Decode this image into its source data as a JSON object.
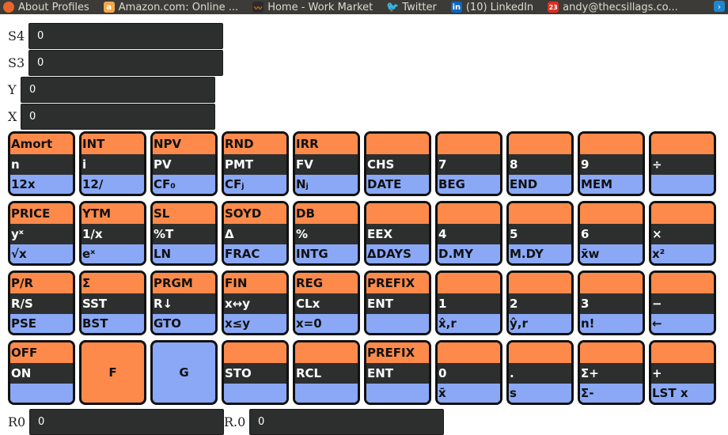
{
  "bookmarks": [
    {
      "label": "About Profiles",
      "icon": "firefox-icon",
      "color": "#e8662c"
    },
    {
      "label": "Amazon.com: Online ...",
      "icon": "amazon-icon",
      "color": "#f3a847"
    },
    {
      "label": "Home - Work Market",
      "icon": "workmarket-icon",
      "color": "#e8781f"
    },
    {
      "label": "Twitter",
      "icon": "twitter-icon",
      "color": "#1da1f2"
    },
    {
      "label": "(10) LinkedIn",
      "icon": "linkedin-icon",
      "color": "#0a66c2"
    },
    {
      "label": "andy@thecsillags.co...",
      "icon": "calendar-icon",
      "color": "#d93025",
      "badge": "23"
    }
  ],
  "stack": {
    "s4": {
      "label": "S4",
      "value": "0"
    },
    "s3": {
      "label": "S3",
      "value": "0"
    },
    "y": {
      "label": "Y",
      "value": "0"
    },
    "x": {
      "label": "X",
      "value": "0"
    }
  },
  "memory": {
    "r0": {
      "label": "R0",
      "value": "0"
    },
    "r_0": {
      "label": "R.0",
      "value": "0"
    }
  },
  "colors": {
    "orange": "#fd8a4a",
    "dark": "#2d2f2f",
    "blue": "#8aa8f6"
  },
  "keys": [
    [
      {
        "top": "Amort",
        "mid": "n",
        "bot": "12x"
      },
      {
        "top": "INT",
        "mid": "i",
        "bot": "12/"
      },
      {
        "top": "NPV",
        "mid": "PV",
        "bot": "CF₀"
      },
      {
        "top": "RND",
        "mid": "PMT",
        "bot": "CFⱼ"
      },
      {
        "top": "IRR",
        "mid": "FV",
        "bot": "Nⱼ"
      },
      {
        "top": "",
        "mid": "CHS",
        "bot": "DATE"
      },
      {
        "top": "",
        "mid": "7",
        "bot": "BEG"
      },
      {
        "top": "",
        "mid": "8",
        "bot": "END"
      },
      {
        "top": "",
        "mid": "9",
        "bot": "MEM"
      },
      {
        "top": "",
        "mid": "÷",
        "bot": ""
      }
    ],
    [
      {
        "top": "PRICE",
        "mid": "yˣ",
        "bot": "√x"
      },
      {
        "top": "YTM",
        "mid": "1/x",
        "bot": "eˣ"
      },
      {
        "top": "SL",
        "mid": "%T",
        "bot": "LN"
      },
      {
        "top": "SOYD",
        "mid": "Δ",
        "bot": "FRAC"
      },
      {
        "top": "DB",
        "mid": "%",
        "bot": "INTG"
      },
      {
        "top": "",
        "mid": "EEX",
        "bot": "ΔDAYS"
      },
      {
        "top": "",
        "mid": "4",
        "bot": "D.MY"
      },
      {
        "top": "",
        "mid": "5",
        "bot": "M.DY"
      },
      {
        "top": "",
        "mid": "6",
        "bot": "x̄w"
      },
      {
        "top": "",
        "mid": "×",
        "bot": "x²"
      }
    ],
    [
      {
        "top": "P/R",
        "mid": "R/S",
        "bot": "PSE"
      },
      {
        "top": "Σ",
        "mid": "SST",
        "bot": "BST"
      },
      {
        "top": "PRGM",
        "mid": "R↓",
        "bot": "GTO"
      },
      {
        "top": "FIN",
        "mid": "x↔y",
        "bot": "x≤y"
      },
      {
        "top": "REG",
        "mid": "CLx",
        "bot": "x=0"
      },
      {
        "top": "PREFIX",
        "mid": "ENT",
        "bot": ""
      },
      {
        "top": "",
        "mid": "1",
        "bot": "x̂,r"
      },
      {
        "top": "",
        "mid": "2",
        "bot": "ŷ,r"
      },
      {
        "top": "",
        "mid": "3",
        "bot": "n!"
      },
      {
        "top": "",
        "mid": "−",
        "bot": "←"
      }
    ],
    [
      {
        "top": "OFF",
        "mid": "ON",
        "bot": ""
      },
      {
        "solid": "orange",
        "label": "F"
      },
      {
        "solid": "blue",
        "label": "G"
      },
      {
        "top": "",
        "mid": "STO",
        "bot": ""
      },
      {
        "top": "",
        "mid": "RCL",
        "bot": ""
      },
      {
        "top": "PREFIX",
        "mid": "ENT",
        "bot": ""
      },
      {
        "top": "",
        "mid": "0",
        "bot": "x̄"
      },
      {
        "top": "",
        "mid": ".",
        "bot": "s"
      },
      {
        "top": "",
        "mid": "Σ+",
        "bot": "Σ-"
      },
      {
        "top": "",
        "mid": "+",
        "bot": "LST x"
      }
    ]
  ]
}
